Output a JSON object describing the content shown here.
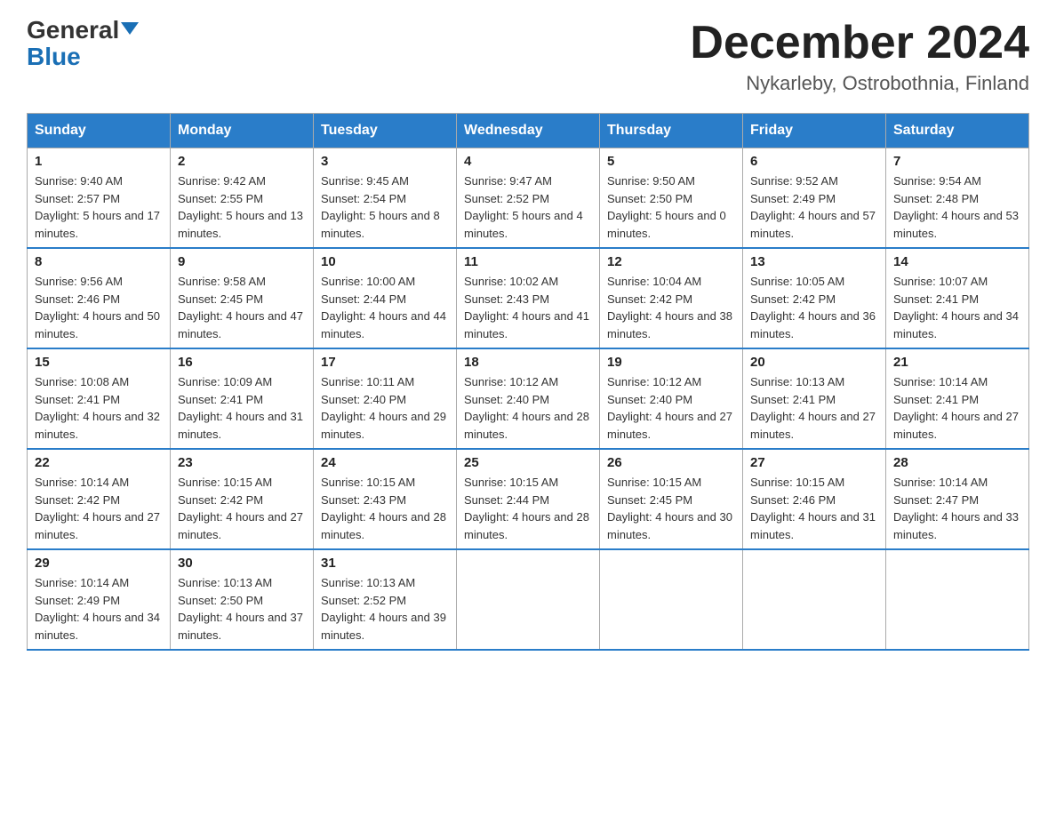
{
  "header": {
    "logo_part1": "General",
    "logo_part2": "Blue",
    "month_title": "December 2024",
    "subtitle": "Nykarleby, Ostrobothnia, Finland"
  },
  "weekdays": [
    "Sunday",
    "Monday",
    "Tuesday",
    "Wednesday",
    "Thursday",
    "Friday",
    "Saturday"
  ],
  "weeks": [
    [
      {
        "day": "1",
        "sunrise": "Sunrise: 9:40 AM",
        "sunset": "Sunset: 2:57 PM",
        "daylight": "Daylight: 5 hours and 17 minutes."
      },
      {
        "day": "2",
        "sunrise": "Sunrise: 9:42 AM",
        "sunset": "Sunset: 2:55 PM",
        "daylight": "Daylight: 5 hours and 13 minutes."
      },
      {
        "day": "3",
        "sunrise": "Sunrise: 9:45 AM",
        "sunset": "Sunset: 2:54 PM",
        "daylight": "Daylight: 5 hours and 8 minutes."
      },
      {
        "day": "4",
        "sunrise": "Sunrise: 9:47 AM",
        "sunset": "Sunset: 2:52 PM",
        "daylight": "Daylight: 5 hours and 4 minutes."
      },
      {
        "day": "5",
        "sunrise": "Sunrise: 9:50 AM",
        "sunset": "Sunset: 2:50 PM",
        "daylight": "Daylight: 5 hours and 0 minutes."
      },
      {
        "day": "6",
        "sunrise": "Sunrise: 9:52 AM",
        "sunset": "Sunset: 2:49 PM",
        "daylight": "Daylight: 4 hours and 57 minutes."
      },
      {
        "day": "7",
        "sunrise": "Sunrise: 9:54 AM",
        "sunset": "Sunset: 2:48 PM",
        "daylight": "Daylight: 4 hours and 53 minutes."
      }
    ],
    [
      {
        "day": "8",
        "sunrise": "Sunrise: 9:56 AM",
        "sunset": "Sunset: 2:46 PM",
        "daylight": "Daylight: 4 hours and 50 minutes."
      },
      {
        "day": "9",
        "sunrise": "Sunrise: 9:58 AM",
        "sunset": "Sunset: 2:45 PM",
        "daylight": "Daylight: 4 hours and 47 minutes."
      },
      {
        "day": "10",
        "sunrise": "Sunrise: 10:00 AM",
        "sunset": "Sunset: 2:44 PM",
        "daylight": "Daylight: 4 hours and 44 minutes."
      },
      {
        "day": "11",
        "sunrise": "Sunrise: 10:02 AM",
        "sunset": "Sunset: 2:43 PM",
        "daylight": "Daylight: 4 hours and 41 minutes."
      },
      {
        "day": "12",
        "sunrise": "Sunrise: 10:04 AM",
        "sunset": "Sunset: 2:42 PM",
        "daylight": "Daylight: 4 hours and 38 minutes."
      },
      {
        "day": "13",
        "sunrise": "Sunrise: 10:05 AM",
        "sunset": "Sunset: 2:42 PM",
        "daylight": "Daylight: 4 hours and 36 minutes."
      },
      {
        "day": "14",
        "sunrise": "Sunrise: 10:07 AM",
        "sunset": "Sunset: 2:41 PM",
        "daylight": "Daylight: 4 hours and 34 minutes."
      }
    ],
    [
      {
        "day": "15",
        "sunrise": "Sunrise: 10:08 AM",
        "sunset": "Sunset: 2:41 PM",
        "daylight": "Daylight: 4 hours and 32 minutes."
      },
      {
        "day": "16",
        "sunrise": "Sunrise: 10:09 AM",
        "sunset": "Sunset: 2:41 PM",
        "daylight": "Daylight: 4 hours and 31 minutes."
      },
      {
        "day": "17",
        "sunrise": "Sunrise: 10:11 AM",
        "sunset": "Sunset: 2:40 PM",
        "daylight": "Daylight: 4 hours and 29 minutes."
      },
      {
        "day": "18",
        "sunrise": "Sunrise: 10:12 AM",
        "sunset": "Sunset: 2:40 PM",
        "daylight": "Daylight: 4 hours and 28 minutes."
      },
      {
        "day": "19",
        "sunrise": "Sunrise: 10:12 AM",
        "sunset": "Sunset: 2:40 PM",
        "daylight": "Daylight: 4 hours and 27 minutes."
      },
      {
        "day": "20",
        "sunrise": "Sunrise: 10:13 AM",
        "sunset": "Sunset: 2:41 PM",
        "daylight": "Daylight: 4 hours and 27 minutes."
      },
      {
        "day": "21",
        "sunrise": "Sunrise: 10:14 AM",
        "sunset": "Sunset: 2:41 PM",
        "daylight": "Daylight: 4 hours and 27 minutes."
      }
    ],
    [
      {
        "day": "22",
        "sunrise": "Sunrise: 10:14 AM",
        "sunset": "Sunset: 2:42 PM",
        "daylight": "Daylight: 4 hours and 27 minutes."
      },
      {
        "day": "23",
        "sunrise": "Sunrise: 10:15 AM",
        "sunset": "Sunset: 2:42 PM",
        "daylight": "Daylight: 4 hours and 27 minutes."
      },
      {
        "day": "24",
        "sunrise": "Sunrise: 10:15 AM",
        "sunset": "Sunset: 2:43 PM",
        "daylight": "Daylight: 4 hours and 28 minutes."
      },
      {
        "day": "25",
        "sunrise": "Sunrise: 10:15 AM",
        "sunset": "Sunset: 2:44 PM",
        "daylight": "Daylight: 4 hours and 28 minutes."
      },
      {
        "day": "26",
        "sunrise": "Sunrise: 10:15 AM",
        "sunset": "Sunset: 2:45 PM",
        "daylight": "Daylight: 4 hours and 30 minutes."
      },
      {
        "day": "27",
        "sunrise": "Sunrise: 10:15 AM",
        "sunset": "Sunset: 2:46 PM",
        "daylight": "Daylight: 4 hours and 31 minutes."
      },
      {
        "day": "28",
        "sunrise": "Sunrise: 10:14 AM",
        "sunset": "Sunset: 2:47 PM",
        "daylight": "Daylight: 4 hours and 33 minutes."
      }
    ],
    [
      {
        "day": "29",
        "sunrise": "Sunrise: 10:14 AM",
        "sunset": "Sunset: 2:49 PM",
        "daylight": "Daylight: 4 hours and 34 minutes."
      },
      {
        "day": "30",
        "sunrise": "Sunrise: 10:13 AM",
        "sunset": "Sunset: 2:50 PM",
        "daylight": "Daylight: 4 hours and 37 minutes."
      },
      {
        "day": "31",
        "sunrise": "Sunrise: 10:13 AM",
        "sunset": "Sunset: 2:52 PM",
        "daylight": "Daylight: 4 hours and 39 minutes."
      },
      null,
      null,
      null,
      null
    ]
  ]
}
